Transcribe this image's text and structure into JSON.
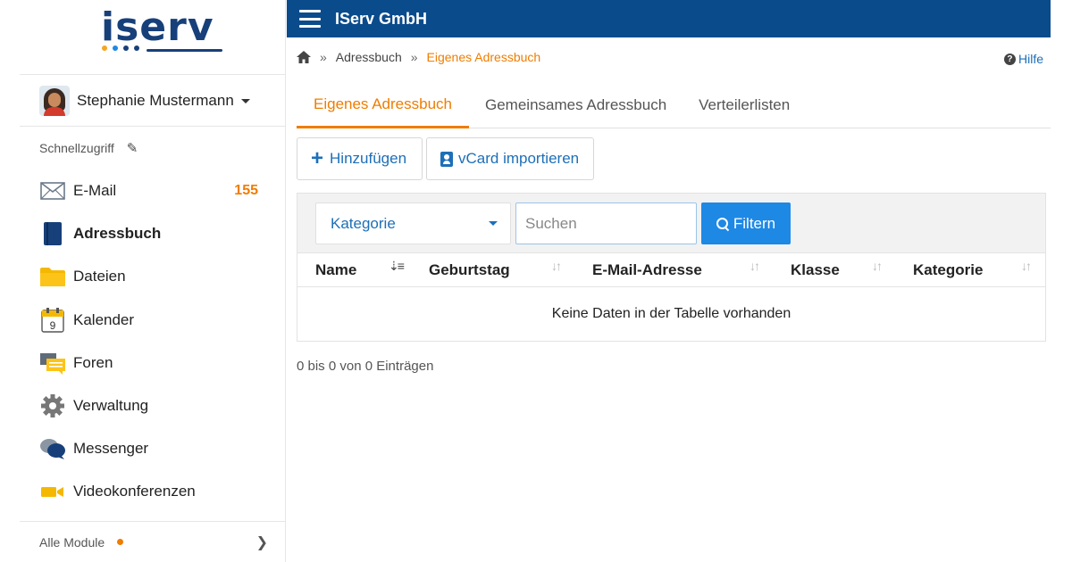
{
  "logo": {
    "text": "iserv",
    "line_color": "#17407a",
    "dot_colors": [
      "#f5a623",
      "#1e88e5",
      "#17407a",
      "#17407a"
    ]
  },
  "user": {
    "name": "Stephanie Mustermann"
  },
  "sidebar": {
    "quick_access_label": "Schnellzugriff",
    "items": [
      {
        "label": "E-Mail",
        "icon": "envelope-icon",
        "badge": "155"
      },
      {
        "label": "Adressbuch",
        "icon": "address-book-icon",
        "active": true
      },
      {
        "label": "Dateien",
        "icon": "folder-icon"
      },
      {
        "label": "Kalender",
        "icon": "calendar-icon",
        "day": "9"
      },
      {
        "label": "Foren",
        "icon": "forum-icon"
      },
      {
        "label": "Verwaltung",
        "icon": "gear-icon"
      },
      {
        "label": "Messenger",
        "icon": "chat-bubbles-icon"
      },
      {
        "label": "Videokonferenzen",
        "icon": "video-camera-icon"
      }
    ],
    "all_modules_label": "Alle Module"
  },
  "header": {
    "title": "IServ GmbH",
    "color": "#0a4b8c"
  },
  "breadcrumb": {
    "sep": "»",
    "parent": "Adressbuch",
    "current": "Eigenes Adressbuch"
  },
  "help": {
    "label": "Hilfe",
    "icon": "question-circle-icon"
  },
  "tabs": [
    {
      "label": "Eigenes Adressbuch",
      "active": true
    },
    {
      "label": "Gemeinsames Adressbuch"
    },
    {
      "label": "Verteilerlisten"
    }
  ],
  "actions": {
    "add_label": "Hinzufügen",
    "vcard_label": "vCard importieren"
  },
  "filter": {
    "category_label": "Kategorie",
    "search_placeholder": "Suchen",
    "search_value": "",
    "button_label": "Filtern"
  },
  "table": {
    "columns": [
      "Name",
      "Geburtstag",
      "E-Mail-Adresse",
      "Klasse",
      "Kategorie"
    ],
    "sorted_column": "Name",
    "empty_message": "Keine Daten in der Tabelle vorhanden"
  },
  "info": "0 bis 0 von 0 Einträgen",
  "colors": {
    "accent": "#ef7d00",
    "link": "#1d6fb8",
    "primary_button": "#1e88e5"
  }
}
